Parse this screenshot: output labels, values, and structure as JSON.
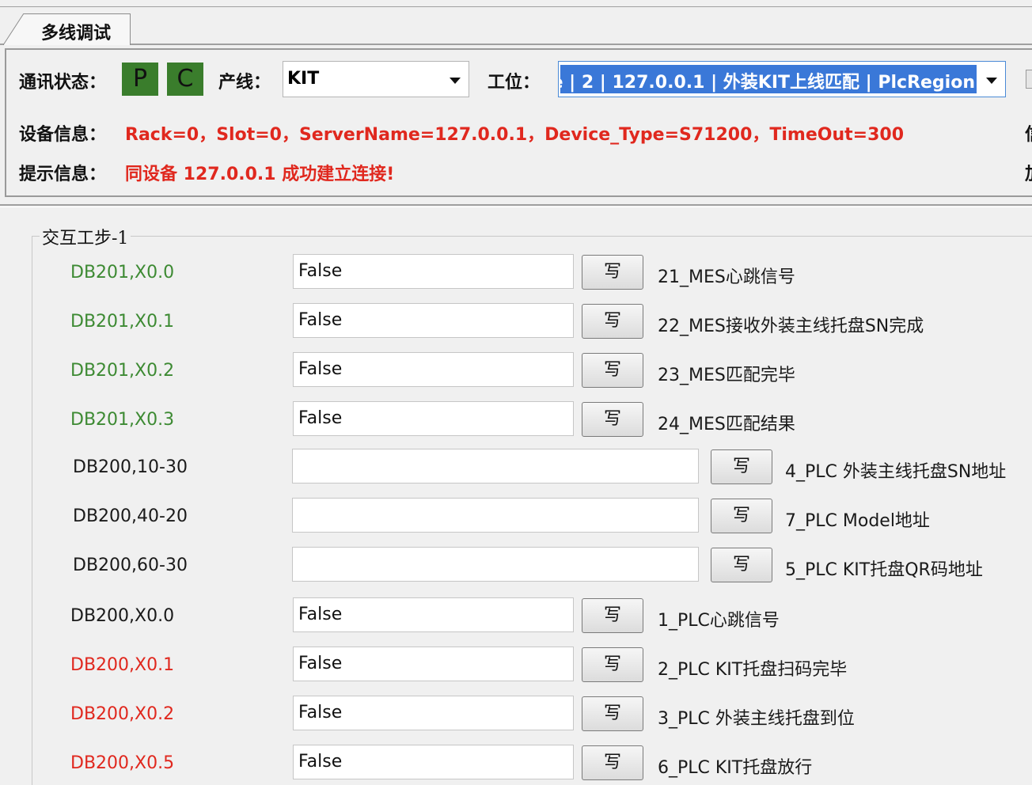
{
  "tab": {
    "label": "多线调试"
  },
  "header": {
    "comm_label": "通讯状态：",
    "led_p": "P",
    "led_c": "C",
    "line_label": "产线：",
    "line_value": "KIT",
    "station_label": "工位：",
    "station_value": "e | 2 | 127.0.0.1 | 外装KIT上线匹配 | PlcRegion",
    "device_label": "设备信息：",
    "device_value": "Rack=0，Slot=0，ServerName=127.0.0.1，Device_Type=S71200，TimeOut=300",
    "hint_label": "提示信息：",
    "hint_value": "同设备 127.0.0.1 成功建立连接!",
    "right_cut_1": "信",
    "right_cut_2": "加"
  },
  "group": {
    "title": "交互工步-1",
    "write_label": "写",
    "rows": [
      {
        "address": "DB201,X0.0",
        "value": "False",
        "desc": "21_MES心跳信号"
      },
      {
        "address": "DB201,X0.1",
        "value": "False",
        "desc": "22_MES接收外装主线托盘SN完成"
      },
      {
        "address": "DB201,X0.2",
        "value": "False",
        "desc": "23_MES匹配完毕"
      },
      {
        "address": "DB201,X0.3",
        "value": "False",
        "desc": "24_MES匹配结果"
      },
      {
        "address": "DB200,10-30",
        "value": "",
        "desc": "4_PLC 外装主线托盘SN地址"
      },
      {
        "address": "DB200,40-20",
        "value": "",
        "desc": "7_PLC Model地址"
      },
      {
        "address": "DB200,60-30",
        "value": "",
        "desc": "5_PLC KIT托盘QR码地址"
      },
      {
        "address": "DB200,X0.0",
        "value": "False",
        "desc": "1_PLC心跳信号"
      },
      {
        "address": "DB200,X0.1",
        "value": "False",
        "desc": "2_PLC KIT托盘扫码完毕"
      },
      {
        "address": "DB200,X0.2",
        "value": "False",
        "desc": "3_PLC 外装主线托盘到位"
      },
      {
        "address": "DB200,X0.5",
        "value": "False",
        "desc": "6_PLC KIT托盘放行"
      }
    ]
  },
  "colors": {
    "green": "#3d8a33",
    "red": "#e0281e",
    "blue": "#2a50e6",
    "led": "#3a7d2c",
    "selection": "#3a78d8"
  }
}
